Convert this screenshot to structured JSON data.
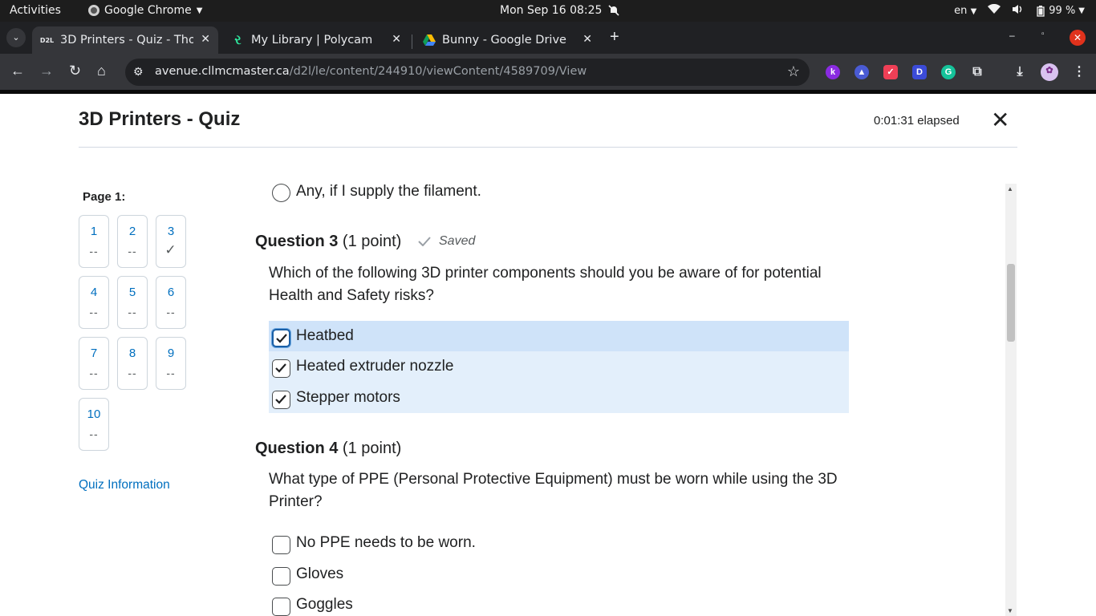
{
  "system": {
    "activities": "Activities",
    "app_name": "Google Chrome",
    "clock": "Mon Sep 16  08:25",
    "lang": "en",
    "battery": "99 %"
  },
  "tabs": [
    {
      "favicon": "D2L",
      "title": "3D Printers - Quiz - Thod"
    },
    {
      "title": "My Library | Polycam"
    },
    {
      "title": "Bunny - Google Drive"
    }
  ],
  "toolbar": {
    "url_host": "avenue.cllmcmaster.ca",
    "url_path": "/d2l/le/content/244910/viewContent/4589709/View"
  },
  "quiz": {
    "title": "3D Printers - Quiz",
    "elapsed": "0:01:31 elapsed",
    "page_label": "Page 1:",
    "question_nav": [
      {
        "num": "1",
        "status": "--"
      },
      {
        "num": "2",
        "status": "--"
      },
      {
        "num": "3",
        "status": "✓"
      },
      {
        "num": "4",
        "status": "--"
      },
      {
        "num": "5",
        "status": "--"
      },
      {
        "num": "6",
        "status": "--"
      },
      {
        "num": "7",
        "status": "--"
      },
      {
        "num": "8",
        "status": "--"
      },
      {
        "num": "9",
        "status": "--"
      },
      {
        "num": "10",
        "status": "--"
      }
    ],
    "quiz_info": "Quiz Information",
    "prev_answer": "Any, if I supply the filament.",
    "q3": {
      "label": "Question 3",
      "points": "(1 point)",
      "saved": "Saved",
      "text": "Which of the following 3D printer components should you be aware of for potential Health and Safety risks?",
      "answers": [
        "Heatbed",
        "Heated extruder nozzle",
        "Stepper motors"
      ]
    },
    "q4": {
      "label": "Question 4",
      "points": "(1 point)",
      "text": "What type of PPE (Personal Protective Equipment) must be worn while using the 3D Printer?",
      "answers": [
        "No PPE needs to be worn.",
        "Gloves",
        "Goggles"
      ]
    }
  }
}
